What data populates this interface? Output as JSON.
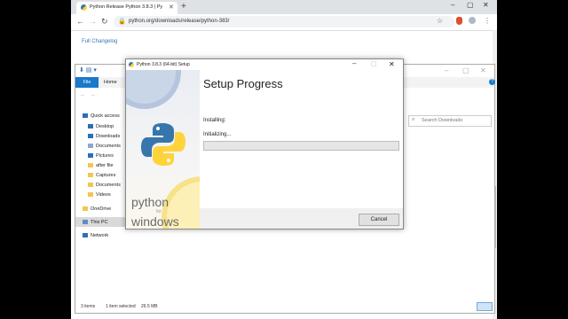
{
  "browser": {
    "tab_title": "Python Release Python 3.8.3 | Py",
    "url": "python.org/downloads/release/python-383/",
    "changelog_link": "Full Changelog"
  },
  "explorer": {
    "file_tab": "File",
    "home_tab": "Home",
    "search_placeholder": "Search Downloads",
    "nav": [
      {
        "label": "Quick access",
        "icon": "star-icon"
      },
      {
        "label": "Desktop",
        "icon": "desktop-icon"
      },
      {
        "label": "Downloads",
        "icon": "download-icon"
      },
      {
        "label": "Documents",
        "icon": "documents-icon"
      },
      {
        "label": "Pictures",
        "icon": "pictures-icon"
      },
      {
        "label": "after file",
        "icon": "folder-icon"
      },
      {
        "label": "Captures",
        "icon": "folder-icon"
      },
      {
        "label": "Documents",
        "icon": "folder-icon"
      },
      {
        "label": "Videos",
        "icon": "folder-icon"
      },
      {
        "label": "OneDrive",
        "icon": "onedrive-icon"
      },
      {
        "label": "This PC",
        "icon": "computer-icon"
      },
      {
        "label": "Network",
        "icon": "network-icon"
      }
    ],
    "status_items": "3 items",
    "status_selected": "1 item selected",
    "status_size": "26.5 MB"
  },
  "setup": {
    "title": "Python 3.8.3 (64-bit) Setup",
    "heading": "Setup Progress",
    "installing_label": "Installing:",
    "status_text": "Initializing...",
    "progress": 0,
    "brand_python": "python",
    "brand_for": "for",
    "brand_windows": "windows",
    "cancel_label": "Cancel"
  },
  "colors": {
    "accent": "#1979ca",
    "python_blue": "#3776ab",
    "python_yellow": "#ffd43b",
    "link": "#3b73b9",
    "progress_green": "#06b025"
  }
}
